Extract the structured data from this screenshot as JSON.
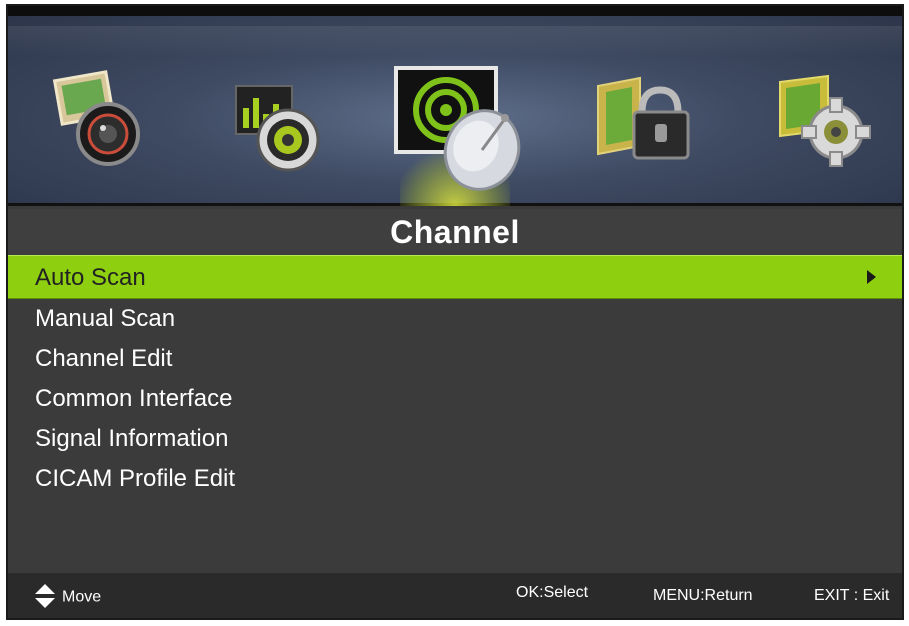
{
  "menu": {
    "title": "Channel",
    "icons": [
      {
        "name": "picture-icon",
        "label": ""
      },
      {
        "name": "sound-icon",
        "label": ""
      },
      {
        "name": "channel-icon",
        "label": ""
      },
      {
        "name": "lock-icon",
        "label": ""
      },
      {
        "name": "setup-icon",
        "label": ""
      }
    ],
    "active_icon": "channel-icon",
    "items": [
      {
        "label": "Auto Scan",
        "selected": true
      },
      {
        "label": "Manual Scan",
        "selected": false
      },
      {
        "label": "Channel Edit",
        "selected": false
      },
      {
        "label": "Common Interface",
        "selected": false
      },
      {
        "label": "Signal Information",
        "selected": false
      },
      {
        "label": "CICAM Profile Edit",
        "selected": false
      }
    ]
  },
  "footer": {
    "move": "Move",
    "ok": "OK:Select",
    "menu": "MENU:Return",
    "exit": "EXIT : Exit"
  },
  "colors": {
    "highlight": "#8ed00f",
    "panel": "#3b3b3b",
    "footer": "#2a2a2a"
  }
}
